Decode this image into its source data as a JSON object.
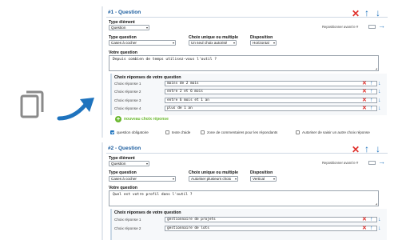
{
  "copy_icon": "copy-icon",
  "action_arrow_icon": "curved-arrow-icon",
  "colors": {
    "accent": "#1e73be",
    "delete": "#e0302b",
    "add": "#6ab82f",
    "title": "#1a5c9e"
  },
  "question1": {
    "title": "#1 - Question",
    "type_element_label": "Type élément",
    "type_element_value": "Question",
    "reposition_label": "Repositionner avant le #",
    "type_question_label": "Type question",
    "type_question_value": "Cases à cocher",
    "choice_mode_label": "Choix unique ou multiple",
    "choice_mode_value": "Un seul choix autorisé",
    "disposition_label": "Disposition",
    "disposition_value": "Horizontal",
    "question_label": "Votre question",
    "question_text": "Depuis combien de temps utilisez-vous l'outil ?",
    "choices_title": "Choix réponses de votre question",
    "choices": [
      {
        "label": "Choix réponse 1",
        "value": "moins de 2 mois"
      },
      {
        "label": "Choix réponse 2",
        "value": "entre 2 et 6 mois"
      },
      {
        "label": "Choix réponse 3",
        "value": "entre 6 mois et 1 an"
      },
      {
        "label": "Choix réponse 4",
        "value": "plus de 1 an"
      }
    ],
    "add_choice_label": "nouveau choix réponse",
    "options": [
      {
        "label": "question obligatoire",
        "checked": true
      },
      {
        "label": "texte d'aide",
        "checked": false
      },
      {
        "label": "zone de commentaires pour les répondants",
        "checked": false
      },
      {
        "label": "Autoriser de saisir un autre choix réponse",
        "checked": false
      }
    ]
  },
  "question2": {
    "title": "#2 - Question",
    "type_element_label": "Type élément",
    "type_element_value": "Question",
    "reposition_label": "Repositionner avant le #",
    "type_question_label": "Type question",
    "type_question_value": "Cases à cocher",
    "choice_mode_label": "Choix unique ou multiple",
    "choice_mode_value": "Autoriser plusieurs choix",
    "disposition_label": "Disposition",
    "disposition_value": "Vertical",
    "question_label": "Votre question",
    "question_text": "Quel est votre profil dans l'outil ?",
    "choices_title": "Choix réponses de votre question",
    "choices": [
      {
        "label": "Choix réponse 1",
        "value": "gestionnaire de projets"
      },
      {
        "label": "Choix réponse 2",
        "value": "gestionnaire de lots"
      }
    ]
  }
}
